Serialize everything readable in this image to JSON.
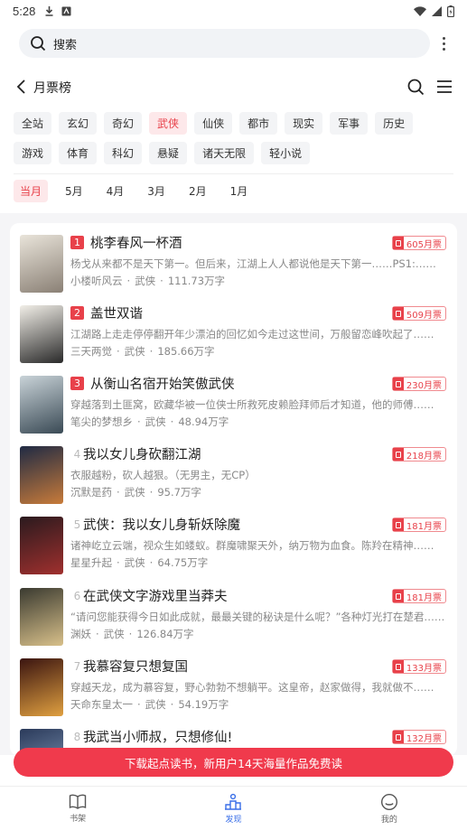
{
  "status_bar": {
    "time": "5:28"
  },
  "search": {
    "placeholder": "搜索"
  },
  "nav": {
    "title": "月票榜"
  },
  "categories": [
    {
      "label": "全站",
      "active": false
    },
    {
      "label": "玄幻",
      "active": false
    },
    {
      "label": "奇幻",
      "active": false
    },
    {
      "label": "武侠",
      "active": true
    },
    {
      "label": "仙侠",
      "active": false
    },
    {
      "label": "都市",
      "active": false
    },
    {
      "label": "现实",
      "active": false
    },
    {
      "label": "军事",
      "active": false
    },
    {
      "label": "历史",
      "active": false
    },
    {
      "label": "游戏",
      "active": false
    },
    {
      "label": "体育",
      "active": false
    },
    {
      "label": "科幻",
      "active": false
    },
    {
      "label": "悬疑",
      "active": false
    },
    {
      "label": "诸天无限",
      "active": false
    },
    {
      "label": "轻小说",
      "active": false
    }
  ],
  "months": [
    {
      "label": "当月",
      "active": true
    },
    {
      "label": "5月",
      "active": false
    },
    {
      "label": "4月",
      "active": false
    },
    {
      "label": "3月",
      "active": false
    },
    {
      "label": "2月",
      "active": false
    },
    {
      "label": "1月",
      "active": false
    }
  ],
  "books": [
    {
      "rank": "1",
      "title": "桃李春风一杯酒",
      "tickets": "605月票",
      "desc": "杨戈从来都不是天下第一。但后来，江湖上人人都说他是天下第一……PS1:……",
      "author": "小楼听风云",
      "genre": "武侠",
      "words": "111.73万字",
      "cover_colors": [
        "#e9e4da",
        "#8a8075"
      ]
    },
    {
      "rank": "2",
      "title": "盖世双谐",
      "tickets": "509月票",
      "desc": "江湖路上走走停停翻开年少漂泊的回忆如今走过这世间，万般留恋峰吹起了……",
      "author": "三天两觉",
      "genre": "武侠",
      "words": "185.66万字",
      "cover_colors": [
        "#f2efe8",
        "#2a2a2a"
      ]
    },
    {
      "rank": "3",
      "title": "从衡山名宿开始笑傲武侠",
      "tickets": "230月票",
      "desc": "穿越落到土匪窝，欧藏华被一位侠士所救死皮赖脸拜师后才知道，他的师傅……",
      "author": "笔尖的梦想乡",
      "genre": "武侠",
      "words": "48.94万字",
      "cover_colors": [
        "#c9d3d8",
        "#3a4a55"
      ]
    },
    {
      "rank": "4",
      "title": "我以女儿身砍翻江湖",
      "tickets": "218月票",
      "desc": "衣服越粉，砍人越狠。（无男主，无CP）",
      "author": "沉默是药",
      "genre": "武侠",
      "words": "95.7万字",
      "cover_colors": [
        "#1f2a44",
        "#c87b3a"
      ]
    },
    {
      "rank": "5",
      "title": "武侠：我以女儿身斩妖除魔",
      "tickets": "181月票",
      "desc": "诸神屹立云端，视众生如蝼蚁。群魔啸聚天外，纳万物为血食。陈羚在精神……",
      "author": "星星升起",
      "genre": "武侠",
      "words": "64.75万字",
      "cover_colors": [
        "#2a1a1e",
        "#a0302e"
      ]
    },
    {
      "rank": "6",
      "title": "在武侠文字游戏里当莽夫",
      "tickets": "181月票",
      "desc": "“请问您能获得今日如此成就，最最关键的秘诀是什么呢？”各种灯光打在楚君……",
      "author": "渊妖",
      "genre": "武侠",
      "words": "126.84万字",
      "cover_colors": [
        "#3a3a30",
        "#d8c08a"
      ]
    },
    {
      "rank": "7",
      "title": "我慕容复只想复国",
      "tickets": "133月票",
      "desc": "穿越天龙，成为慕容复，野心勃勃不想躺平。这皇帝，赵家做得，我就做不……",
      "author": "天命东皇太一",
      "genre": "武侠",
      "words": "54.19万字",
      "cover_colors": [
        "#3a1410",
        "#e0a040"
      ]
    },
    {
      "rank": "8",
      "title": "我武当小师叔，只想修仙!",
      "tickets": "132月票",
      "desc": "",
      "author": "",
      "genre": "",
      "words": "",
      "cover_colors": [
        "#2a3a5a",
        "#8aa0c0"
      ]
    }
  ],
  "banner": {
    "text": "下载起点读书，新用户14天海量作品免费读"
  },
  "tabs": [
    {
      "label": "书架",
      "icon": "book-icon",
      "active": false
    },
    {
      "label": "发现",
      "icon": "discover-icon",
      "active": true
    },
    {
      "label": "我的",
      "icon": "profile-icon",
      "active": false
    }
  ]
}
